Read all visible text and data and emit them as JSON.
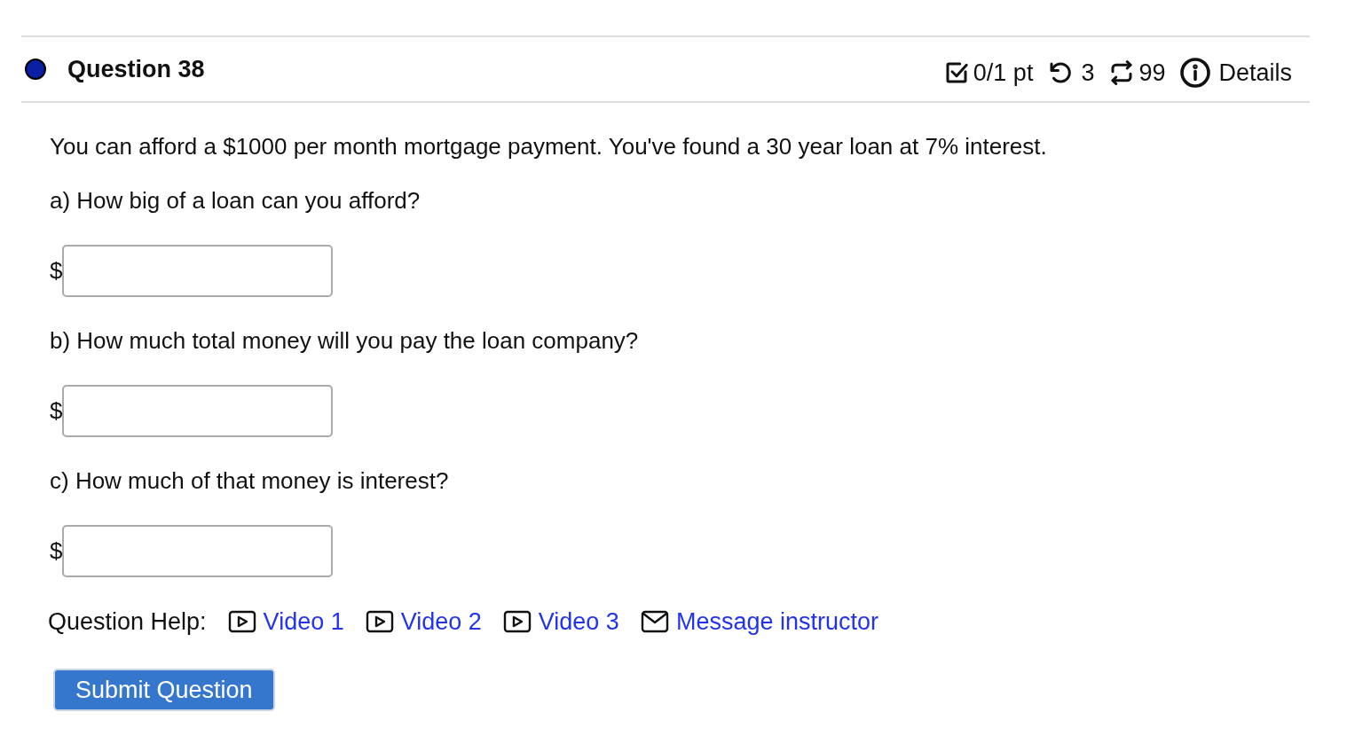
{
  "question": {
    "title": "Question 38",
    "score": "0/1 pt",
    "attempts": "3",
    "versions": "99",
    "details": "Details"
  },
  "prompt": "You can afford a $1000 per month mortgage payment. You've found a 30 year loan at 7% interest.",
  "parts": [
    {
      "label": "a) How big of a loan can you afford?",
      "prefix": "$"
    },
    {
      "label": "b) How much total money will you pay the loan company?",
      "prefix": "$"
    },
    {
      "label": "c) How much of that money is interest?",
      "prefix": "$"
    }
  ],
  "help": {
    "label": "Question Help:",
    "links": [
      {
        "kind": "video",
        "text": "Video 1"
      },
      {
        "kind": "video",
        "text": "Video 2"
      },
      {
        "kind": "video",
        "text": "Video 3"
      },
      {
        "kind": "message",
        "text": "Message instructor"
      }
    ]
  },
  "submit": "Submit Question"
}
